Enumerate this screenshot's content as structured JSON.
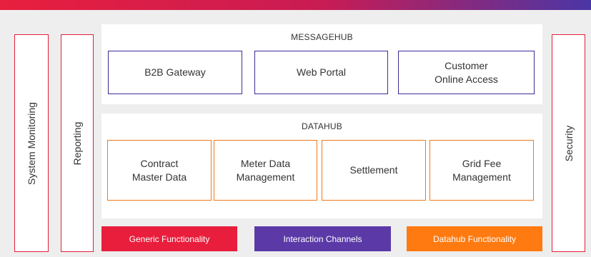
{
  "colors": {
    "red": "#e21f3a",
    "purple": "#3d2d94",
    "orange": "#f07a1a",
    "legend_purple": "#5b3aa7",
    "legend_orange": "#ff7a10"
  },
  "left_bars": [
    {
      "label": "System Monitoring"
    },
    {
      "label": "Reporting"
    }
  ],
  "right_bar": {
    "label": "Security"
  },
  "messagehub": {
    "title": "MESSAGEHUB",
    "boxes": [
      {
        "label": "B2B Gateway"
      },
      {
        "label": "Web Portal"
      },
      {
        "label": "Customer\nOnline Access"
      }
    ]
  },
  "datahub": {
    "title": "DATAHUB",
    "boxes": [
      {
        "label": "Contract\nMaster Data"
      },
      {
        "label": "Meter Data\nManagement"
      },
      {
        "label": "Settlement"
      },
      {
        "label": "Grid Fee\nManagement"
      }
    ]
  },
  "legend": [
    {
      "label": "Generic Functionality",
      "color": "#e81e3c"
    },
    {
      "label": "Interaction Channels",
      "color": "#5b3aa7"
    },
    {
      "label": "Datahub Functionality",
      "color": "#ff7a10"
    }
  ]
}
